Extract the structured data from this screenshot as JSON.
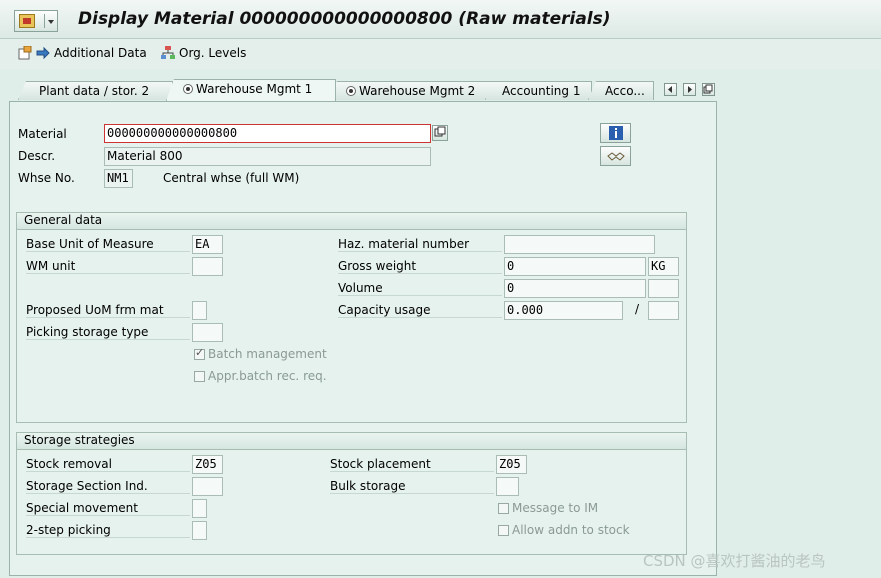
{
  "header": {
    "title": "Display Material 000000000000000800 (Raw materials)"
  },
  "toolbar": {
    "additional_data": "Additional Data",
    "org_levels": "Org. Levels"
  },
  "tabs": [
    {
      "label": "Plant data / stor. 2"
    },
    {
      "label": "Warehouse Mgmt 1",
      "active": true
    },
    {
      "label": "Warehouse Mgmt 2"
    },
    {
      "label": "Accounting 1"
    },
    {
      "label": "Acco..."
    }
  ],
  "material": {
    "material_label": "Material",
    "material_value": "000000000000000800",
    "descr_label": "Descr.",
    "descr_value": "Material 800",
    "whse_label": "Whse No.",
    "whse_value": "NM1",
    "whse_desc": "Central whse (full WM)"
  },
  "general": {
    "title": "General data",
    "base_uom_label": "Base Unit of Measure",
    "base_uom_value": "EA",
    "wm_unit_label": "WM unit",
    "wm_unit_value": "",
    "proposed_uom_label": "Proposed UoM frm mat",
    "picking_label": "Picking storage type",
    "batch_mgmt_label": "Batch management",
    "appr_batch_label": "Appr.batch rec. req.",
    "haz_label": "Haz. material number",
    "haz_value": "",
    "gross_label": "Gross weight",
    "gross_value": "0",
    "gross_unit": "KG",
    "volume_label": "Volume",
    "volume_value": "0",
    "capacity_label": "Capacity usage",
    "capacity_value": "0.000",
    "capacity_sep": "/"
  },
  "storage": {
    "title": "Storage strategies",
    "removal_label": "Stock removal",
    "removal_value": "Z05",
    "section_label": "Storage Section Ind.",
    "special_label": "Special movement",
    "twostep_label": "2-step picking",
    "placement_label": "Stock placement",
    "placement_value": "Z05",
    "bulk_label": "Bulk storage",
    "msg_im_label": "Message to IM",
    "allow_addn_label": "Allow addn to stock"
  },
  "watermark": "CSDN @喜欢打酱油的老鸟",
  "colors": {
    "background": "#dfeee9",
    "panel": "#e6f2ed",
    "border": "#9bb3aa"
  }
}
